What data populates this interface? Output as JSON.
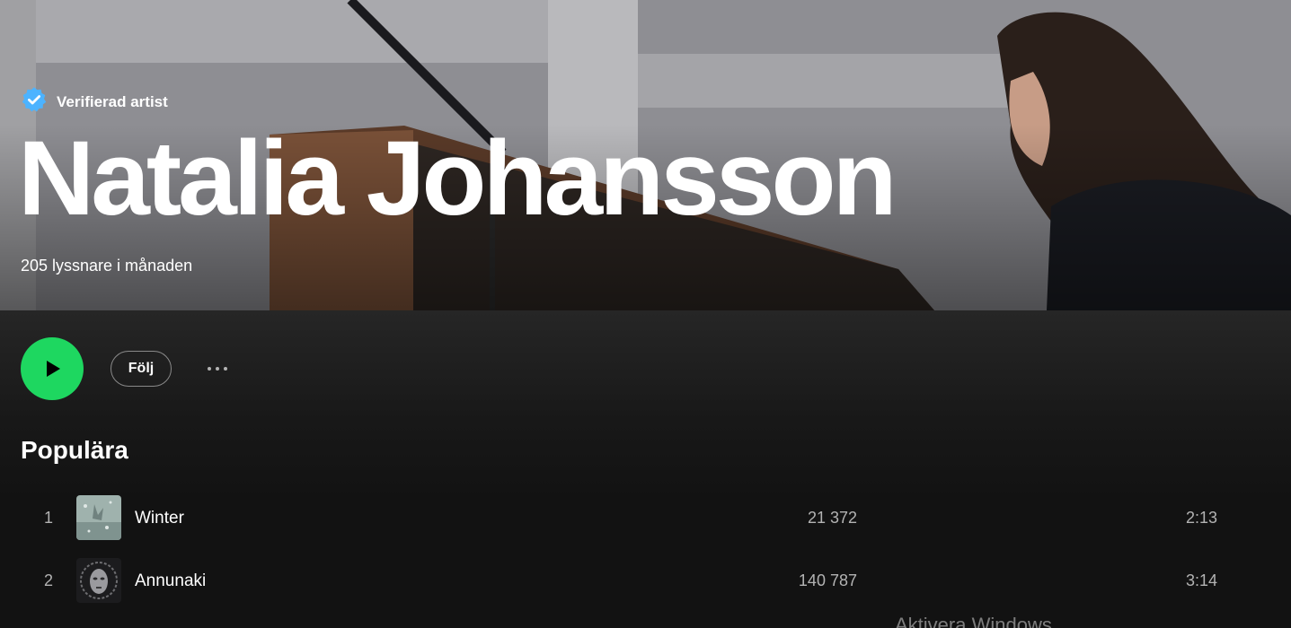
{
  "hero": {
    "verified_label": "Verifierad artist",
    "artist_name": "Natalia Johansson",
    "monthly_listeners": "205 lyssnare i månaden"
  },
  "actions": {
    "follow_label": "Följ"
  },
  "popular": {
    "title": "Populära",
    "tracks": [
      {
        "rank": "1",
        "title": "Winter",
        "plays": "21 372",
        "duration": "2:13"
      },
      {
        "rank": "2",
        "title": "Annunaki",
        "plays": "140 787",
        "duration": "3:14"
      }
    ]
  },
  "system": {
    "watermark": "Aktivera Windows"
  },
  "colors": {
    "play_button": "#1ed760",
    "verified_badge": "#4cb3ff",
    "background": "#121212"
  }
}
